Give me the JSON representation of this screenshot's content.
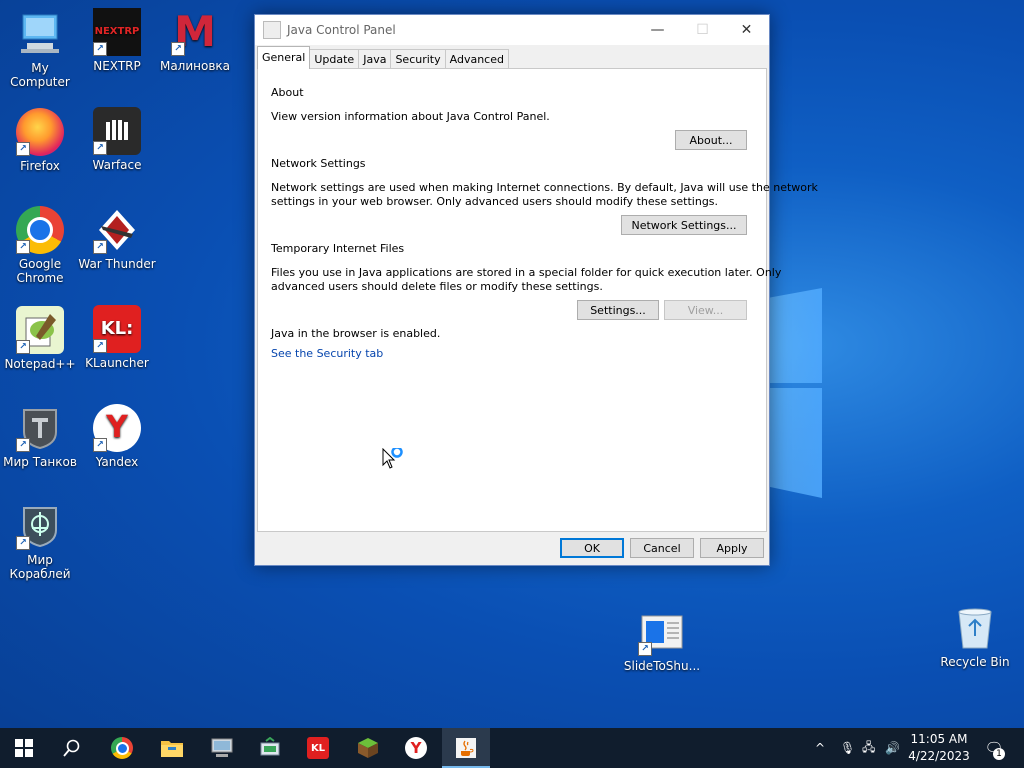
{
  "desktop": {
    "icons": [
      {
        "label": "My Computer",
        "icon": "computer-icon",
        "color": "#4aa3e8"
      },
      {
        "label": "NEXTRP",
        "icon": "nextrp-icon",
        "color": "#111111"
      },
      {
        "label": "Малиновка",
        "icon": "malinovka-icon",
        "color": "#d0263a"
      },
      {
        "label": "Firefox",
        "icon": "firefox-icon",
        "color": "#ff7139"
      },
      {
        "label": "Warface",
        "icon": "warface-icon",
        "color": "#222222"
      },
      {
        "label": "Google Chrome",
        "icon": "chrome-icon",
        "color": "#1a73e8"
      },
      {
        "label": "War Thunder",
        "icon": "war-thunder-icon",
        "color": "#b32020"
      },
      {
        "label": "Notepad++",
        "icon": "notepadpp-icon",
        "color": "#8bc34a"
      },
      {
        "label": "KLauncher",
        "icon": "klauncher-icon",
        "color": "#e02020"
      },
      {
        "label": "Мир Танков",
        "icon": "mir-tankov-icon",
        "color": "#5a5f66"
      },
      {
        "label": "Yandex",
        "icon": "yandex-icon",
        "color": "#ffffff"
      },
      {
        "label": "Мир Кораблей",
        "icon": "mir-korabley-icon",
        "color": "#4a6070"
      },
      {
        "label": "SlideToShu...",
        "icon": "slidetoshutdown-icon",
        "color": "#f2f2f2"
      },
      {
        "label": "Recycle Bin",
        "icon": "recycle-bin-icon",
        "color": "#bcd8ef"
      }
    ],
    "nextrp_logo_text": "NEXTRP",
    "malinovka_logo_text": "M",
    "klauncher_logo_text": "KL:",
    "yandex_logo_text": "Y"
  },
  "window": {
    "title": "Java Control Panel",
    "controls": {
      "minimize": "—",
      "maximize": "☐",
      "close": "✕"
    },
    "tabs": [
      "General",
      "Update",
      "Java",
      "Security",
      "Advanced"
    ],
    "active_tab": "General",
    "about": {
      "heading": "About",
      "description": "View version information about Java Control Panel.",
      "button": "About..."
    },
    "network": {
      "heading": "Network Settings",
      "line1": "Network settings are used when making Internet connections. By default, Java will use the network",
      "line2": "settings in your web browser. Only advanced users should modify these settings.",
      "button": "Network Settings..."
    },
    "temp_files": {
      "heading": "Temporary Internet Files",
      "line1": "Files you use in Java applications are stored in a special folder for quick execution later. Only",
      "line2": "advanced users should delete files or modify these settings.",
      "settings_button": "Settings...",
      "view_button": "View..."
    },
    "browser": {
      "status": "Java in the browser is enabled.",
      "link": "See the Security tab"
    },
    "footer": {
      "ok": "OK",
      "cancel": "Cancel",
      "apply": "Apply"
    }
  },
  "taskbar": {
    "apps": [
      {
        "name": "start",
        "icon": "windows-start-icon"
      },
      {
        "name": "search",
        "icon": "search-icon"
      },
      {
        "name": "chrome",
        "icon": "chrome-icon"
      },
      {
        "name": "file-explorer",
        "icon": "folder-icon"
      },
      {
        "name": "computer-manager",
        "icon": "computer-manager-icon"
      },
      {
        "name": "network-app",
        "icon": "network-app-icon"
      },
      {
        "name": "klauncher",
        "icon": "klauncher-icon"
      },
      {
        "name": "minecraft",
        "icon": "minecraft-icon"
      },
      {
        "name": "yandex",
        "icon": "yandex-icon"
      },
      {
        "name": "java",
        "icon": "java-icon"
      }
    ],
    "klauncher_text": "KL",
    "yandex_text": "Y",
    "time": "11:05 AM",
    "date": "4/22/2023",
    "notification_count": "1",
    "tray_chevron": "^",
    "mic_glyph": "🎙",
    "network_glyph": "🖧",
    "volume_glyph": "🔊",
    "notification_glyph": "🗨"
  }
}
